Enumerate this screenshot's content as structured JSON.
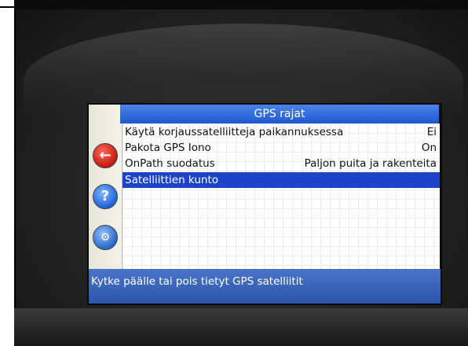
{
  "screen": {
    "title": "GPS rajat",
    "items": [
      {
        "label": "Käytä korjaussatelliitteja paikannuksessa",
        "value": "Ei",
        "selected": false
      },
      {
        "label": "Pakota GPS Iono",
        "value": "On",
        "selected": false
      },
      {
        "label": "OnPath suodatus",
        "value": "Paljon puita ja rakenteita",
        "selected": false
      },
      {
        "label": "Satelliittien kunto",
        "value": "",
        "selected": true
      }
    ],
    "status_text": "Kytke päälle tai pois tietyt GPS satelliitit"
  },
  "icons": {
    "home": "home-icon",
    "help": "help-icon",
    "settings": "settings-icon"
  },
  "colors": {
    "title_bar": "#1e58cf",
    "selected_row": "#1c44c8",
    "home_icon": "#c21a12",
    "help_icon": "#1f62d6"
  }
}
